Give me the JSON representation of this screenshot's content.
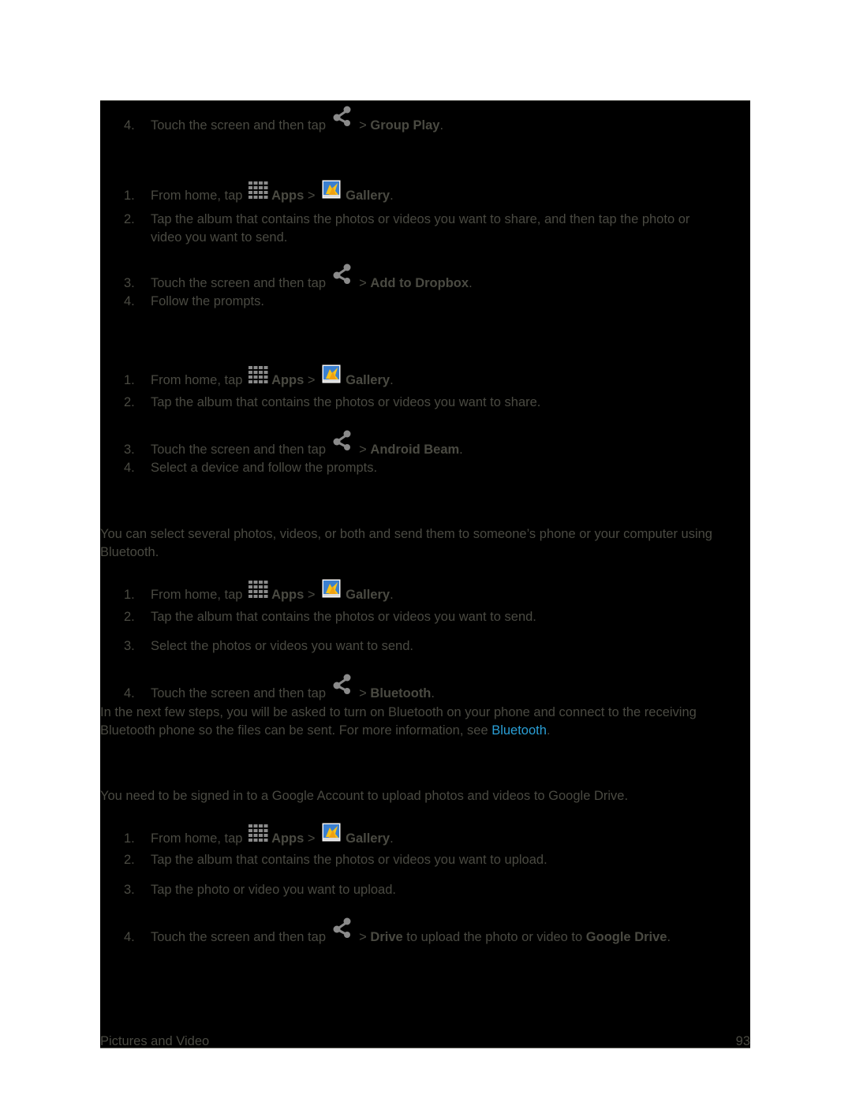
{
  "sections": [
    {
      "steps": [
        {
          "num": "4.",
          "pre": "Touch the screen and then tap",
          "icon": "share-icon",
          "sep": " > ",
          "bold": "Group Play",
          "post": "."
        }
      ]
    },
    {
      "steps": [
        {
          "num": "1.",
          "pre": "From home, tap",
          "apps": "Apps",
          "sep": " > ",
          "gallery": "Gallery",
          "post": "."
        },
        {
          "num": "2.",
          "line1": "Tap the album that contains the photos or videos you want to share, and then tap the photo or",
          "line2": "video you want to send."
        },
        {
          "num": "3.",
          "pre": "Touch the screen and then tap",
          "icon": "share-icon",
          "sep": " > ",
          "bold": "Add to Dropbox",
          "post": "."
        },
        {
          "num": "4.",
          "text": "Follow the prompts."
        }
      ]
    },
    {
      "steps": [
        {
          "num": "1.",
          "pre": "From home, tap",
          "apps": "Apps",
          "sep": " > ",
          "gallery": "Gallery",
          "post": "."
        },
        {
          "num": "2.",
          "text": "Tap the album that contains the photos or videos you want to share."
        },
        {
          "num": "3.",
          "pre": "Touch the screen and then tap",
          "icon": "share-icon",
          "sep": " > ",
          "bold": "Android Beam",
          "post": "."
        },
        {
          "num": "4.",
          "text": "Select a device and follow the prompts."
        }
      ]
    },
    {
      "intro": "You can select several photos, videos, or both and send them to someone’s phone or your computer using Bluetooth.",
      "steps": [
        {
          "num": "1.",
          "pre": "From home, tap",
          "apps": "Apps",
          "sep": " > ",
          "gallery": "Gallery",
          "post": "."
        },
        {
          "num": "2.",
          "text": "Tap the album that contains the photos or videos you want to send."
        },
        {
          "num": "3.",
          "text": "Select the photos or videos you want to send."
        },
        {
          "num": "4.",
          "pre": "Touch the screen and then tap",
          "icon": "share-icon",
          "sep": " > ",
          "bold": "Bluetooth",
          "post": "."
        }
      ],
      "note": {
        "text": "In the next few steps, you will be asked to turn on Bluetooth on your phone and connect to the receiving Bluetooth phone so the files can be sent. For more information, see ",
        "link": "Bluetooth",
        "post": "."
      }
    },
    {
      "intro": "You need to be signed in to a Google Account to upload photos and videos to Google Drive.",
      "steps": [
        {
          "num": "1.",
          "pre": "From home, tap",
          "apps": "Apps",
          "sep": " > ",
          "gallery": "Gallery",
          "post": "."
        },
        {
          "num": "2.",
          "text": "Tap the album that contains the photos or videos you want to upload."
        },
        {
          "num": "3.",
          "text": "Tap the photo or video you want to upload."
        },
        {
          "num": "4.",
          "pre": "Touch the screen and then tap",
          "icon": "share-icon",
          "sep": " > ",
          "bold": "Drive",
          "mid": " to upload the photo or video to ",
          "bold2": "Google Drive",
          "post": "."
        }
      ]
    }
  ],
  "footer": {
    "section_title": "Pictures and Video",
    "page_number": "93"
  },
  "colors": {
    "text": "#4a4a42",
    "link": "#2a9fd6",
    "background": "#000000"
  }
}
